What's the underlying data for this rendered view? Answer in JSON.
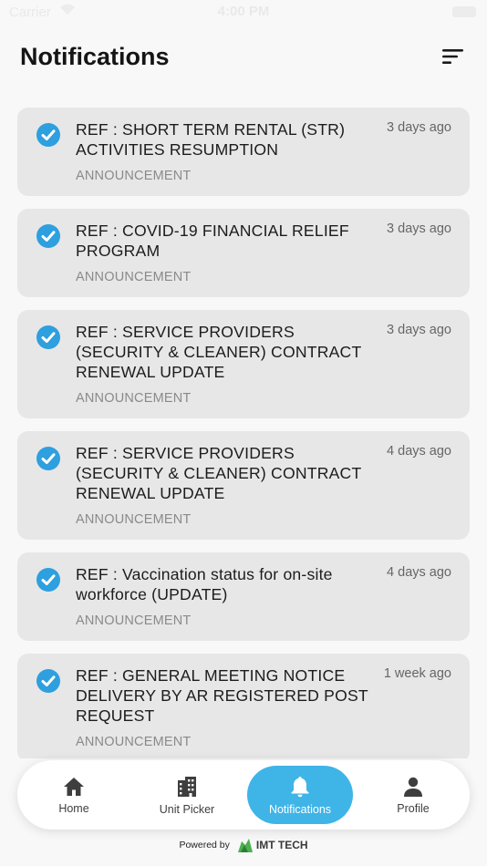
{
  "status_bar": {
    "carrier": "Carrier",
    "time": "4:00 PM"
  },
  "header": {
    "title": "Notifications"
  },
  "notifications": [
    {
      "title": "REF : SHORT TERM RENTAL (STR) ACTIVITIES RESUMPTION",
      "category": "ANNOUNCEMENT",
      "time": "3 days ago"
    },
    {
      "title": "REF : COVID-19 FINANCIAL RELIEF PROGRAM",
      "category": "ANNOUNCEMENT",
      "time": "3 days ago"
    },
    {
      "title": "REF : SERVICE PROVIDERS (SECURITY & CLEANER)  CONTRACT RENEWAL UPDATE",
      "category": "ANNOUNCEMENT",
      "time": "3 days ago"
    },
    {
      "title": "REF : SERVICE PROVIDERS (SECURITY & CLEANER)  CONTRACT RENEWAL UPDATE",
      "category": "ANNOUNCEMENT",
      "time": "4 days ago"
    },
    {
      "title": "REF : Vaccination status for on-site workforce (UPDATE)",
      "category": "ANNOUNCEMENT",
      "time": "4 days ago"
    },
    {
      "title": "REF : GENERAL MEETING NOTICE DELIVERY BY AR REGISTERED POST REQUEST",
      "category": "ANNOUNCEMENT",
      "time": "1 week ago"
    }
  ],
  "tabbar": {
    "home": "Home",
    "unit_picker": "Unit Picker",
    "notifications": "Notifications",
    "profile": "Profile"
  },
  "footer": {
    "powered_by": "Powered by",
    "brand": "IMT TECH"
  },
  "colors": {
    "accent": "#3fb4e7",
    "check": "#2e9fdf",
    "card": "#e7e7e7",
    "background": "#f8f8f8"
  }
}
